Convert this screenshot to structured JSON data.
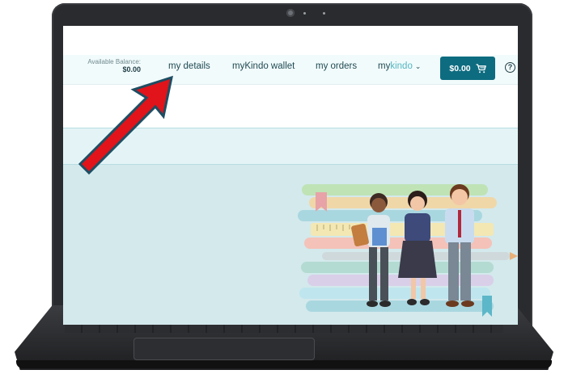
{
  "balance": {
    "label": "Available Balance:",
    "amount": "$0.00"
  },
  "nav": {
    "my_details": "my details",
    "wallet": "myKindo wallet",
    "orders": "my orders",
    "mykindo_prefix": "my",
    "mykindo_suffix": "kindo",
    "mykindo_chevron": "⌄"
  },
  "cart": {
    "amount": "$0.00",
    "icon": "cart-icon"
  },
  "help": {
    "glyph": "?",
    "icon": "help-icon"
  },
  "colors": {
    "brand_teal": "#0e6c80",
    "kindo_accent": "#53b7c2",
    "annotation_arrow": "#e0141a"
  }
}
